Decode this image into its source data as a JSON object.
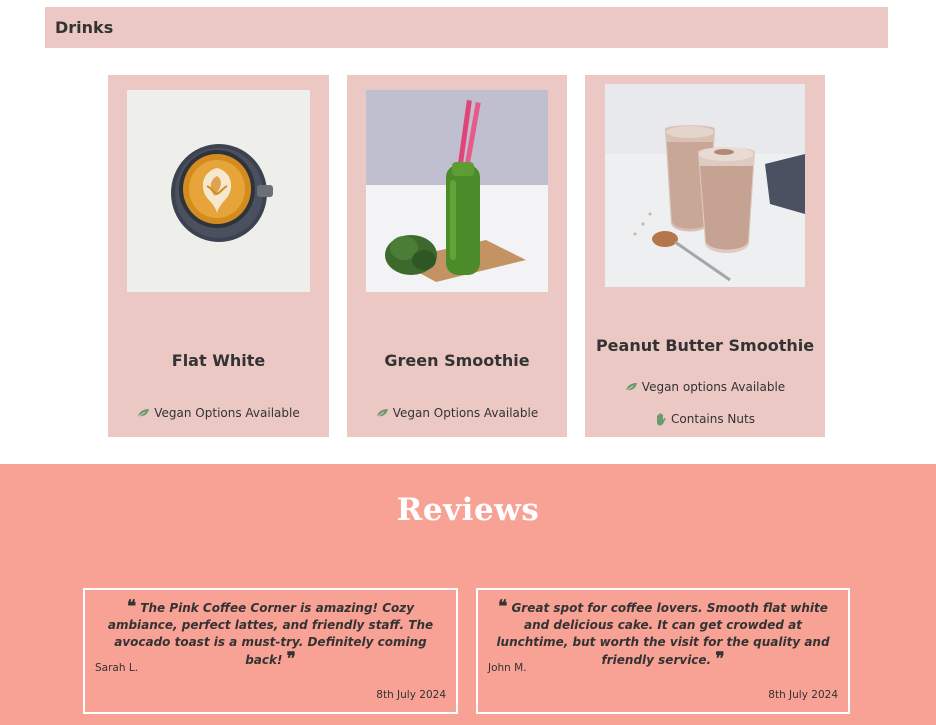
{
  "drinks": {
    "title": "Drinks",
    "items": [
      {
        "name": "Flat White",
        "tags": [
          {
            "icon": "leaf-icon",
            "text": "Vegan Options Available"
          }
        ]
      },
      {
        "name": "Green Smoothie",
        "tags": [
          {
            "icon": "leaf-icon",
            "text": "Vegan Options Available"
          }
        ]
      },
      {
        "name": "Peanut Butter Smoothie",
        "tags": [
          {
            "icon": "leaf-icon",
            "text": "Vegan options Available"
          },
          {
            "icon": "hand-icon",
            "text": "Contains Nuts"
          }
        ]
      }
    ]
  },
  "reviews": {
    "title": "Reviews",
    "items": [
      {
        "quote": "The Pink Coffee Corner is amazing! Cozy ambiance, perfect lattes, and friendly staff. The avocado toast is a must-try. Definitely coming back!",
        "author": "Sarah L.",
        "date": "8th July 2024"
      },
      {
        "quote": "Great spot for coffee lovers. Smooth flat white and delicious cake. It can get crowded at lunchtime, but worth the visit for the quality and friendly service.",
        "author": "John M.",
        "date": "8th July 2024"
      }
    ]
  },
  "colors": {
    "card_bg": "#ebc8c3",
    "reviews_bg": "#f8a195",
    "leaf_green": "#6a9a6e"
  }
}
